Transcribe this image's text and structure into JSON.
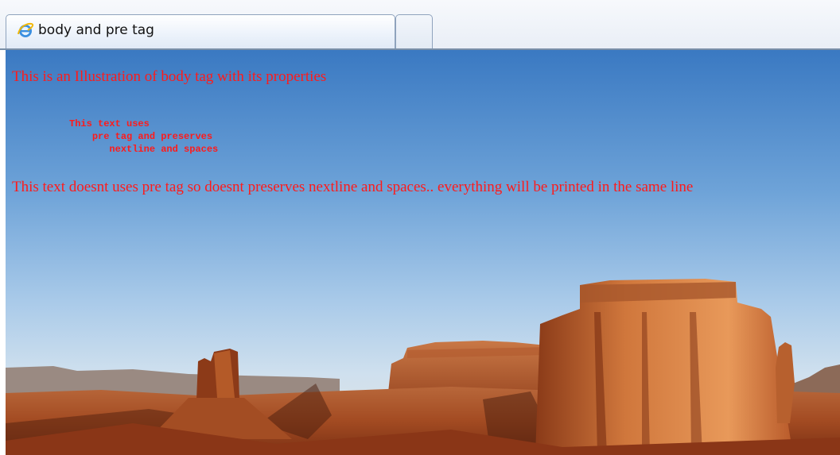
{
  "browser": {
    "tab_title": "body and pre tag",
    "icon": "internet-explorer-icon"
  },
  "page": {
    "text_color": "#ff1a1a",
    "background": "desert-landscape-photo",
    "paragraph1": "This is an Illustration of body tag with its properties",
    "pre_text": "          This text uses\n              pre tag and preserves\n                 nextline and spaces",
    "paragraph2": "This text doesnt uses pre tag so doesnt preserves nextline and spaces.. everything will be printed in the same line"
  }
}
